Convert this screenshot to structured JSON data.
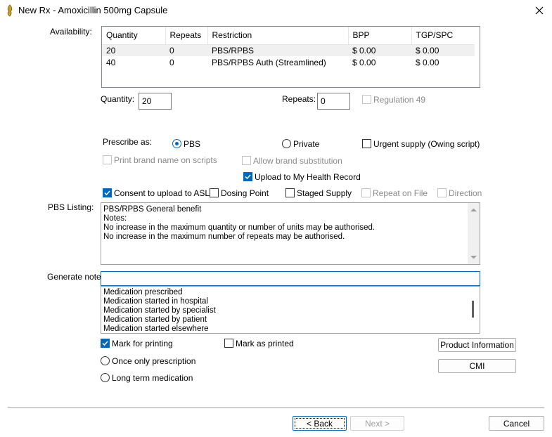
{
  "window": {
    "title": "New Rx - Amoxicillin  500mg Capsule"
  },
  "availability": {
    "label": "Availability:",
    "columns": [
      "Quantity",
      "Repeats",
      "Restriction",
      "BPP",
      "TGP/SPC"
    ],
    "rows": [
      {
        "quantity": "20",
        "repeats": "0",
        "restriction": "PBS/RPBS",
        "bpp": "$ 0.00",
        "tgp": "$ 0.00",
        "selected": true
      },
      {
        "quantity": "40",
        "repeats": "0",
        "restriction": "PBS/RPBS Auth (Streamlined)",
        "bpp": "$ 0.00",
        "tgp": "$ 0.00",
        "selected": false
      }
    ]
  },
  "quantity": {
    "label": "Quantity:",
    "value": "20"
  },
  "repeats": {
    "label": "Repeats:",
    "value": "0"
  },
  "regulation49": {
    "label": "Regulation 49",
    "checked": false,
    "enabled": false
  },
  "prescribe_as": {
    "label": "Prescribe as:",
    "pbs": "PBS",
    "private": "Private",
    "selected": "PBS"
  },
  "urgent_supply": {
    "label": "Urgent supply (Owing script)",
    "checked": false
  },
  "print_brand": {
    "label": "Print brand name on scripts",
    "checked": false,
    "enabled": false
  },
  "allow_brand": {
    "label": "Allow brand substitution",
    "checked": false,
    "enabled": false
  },
  "upload_mhr": {
    "label": "Upload to My Health Record",
    "checked": true
  },
  "consent_asl": {
    "label": "Consent to upload to ASL",
    "checked": true
  },
  "dosing_point": {
    "label": "Dosing Point",
    "checked": false
  },
  "staged_supply": {
    "label": "Staged Supply",
    "checked": false
  },
  "repeat_on_file": {
    "label": "Repeat on File",
    "checked": false,
    "enabled": false
  },
  "direction": {
    "label": "Direction",
    "checked": false,
    "enabled": false
  },
  "pbs_listing": {
    "label": "PBS Listing:",
    "lines": [
      "PBS/RPBS General benefit",
      "Notes:",
      "No increase in the maximum quantity or number of units may be authorised.",
      "No increase in the maximum number of repeats may be authorised."
    ]
  },
  "generate_note": {
    "label": "Generate note:",
    "value": "",
    "options": [
      "Medication prescribed",
      "Medication started in hospital",
      "Medication started by specialist",
      "Medication started by patient",
      "Medication started elsewhere"
    ]
  },
  "mark_for_printing": {
    "label": "Mark for printing",
    "checked": true
  },
  "mark_as_printed": {
    "label": "Mark as printed",
    "checked": false
  },
  "once_only": {
    "label": "Once only prescription"
  },
  "long_term": {
    "label": "Long term medication"
  },
  "buttons": {
    "product_info": "Product Information",
    "cmi": "CMI",
    "back": "< Back",
    "next": "Next >",
    "cancel": "Cancel"
  },
  "colors": {
    "accent": "#0067c0",
    "border": "#828790"
  }
}
